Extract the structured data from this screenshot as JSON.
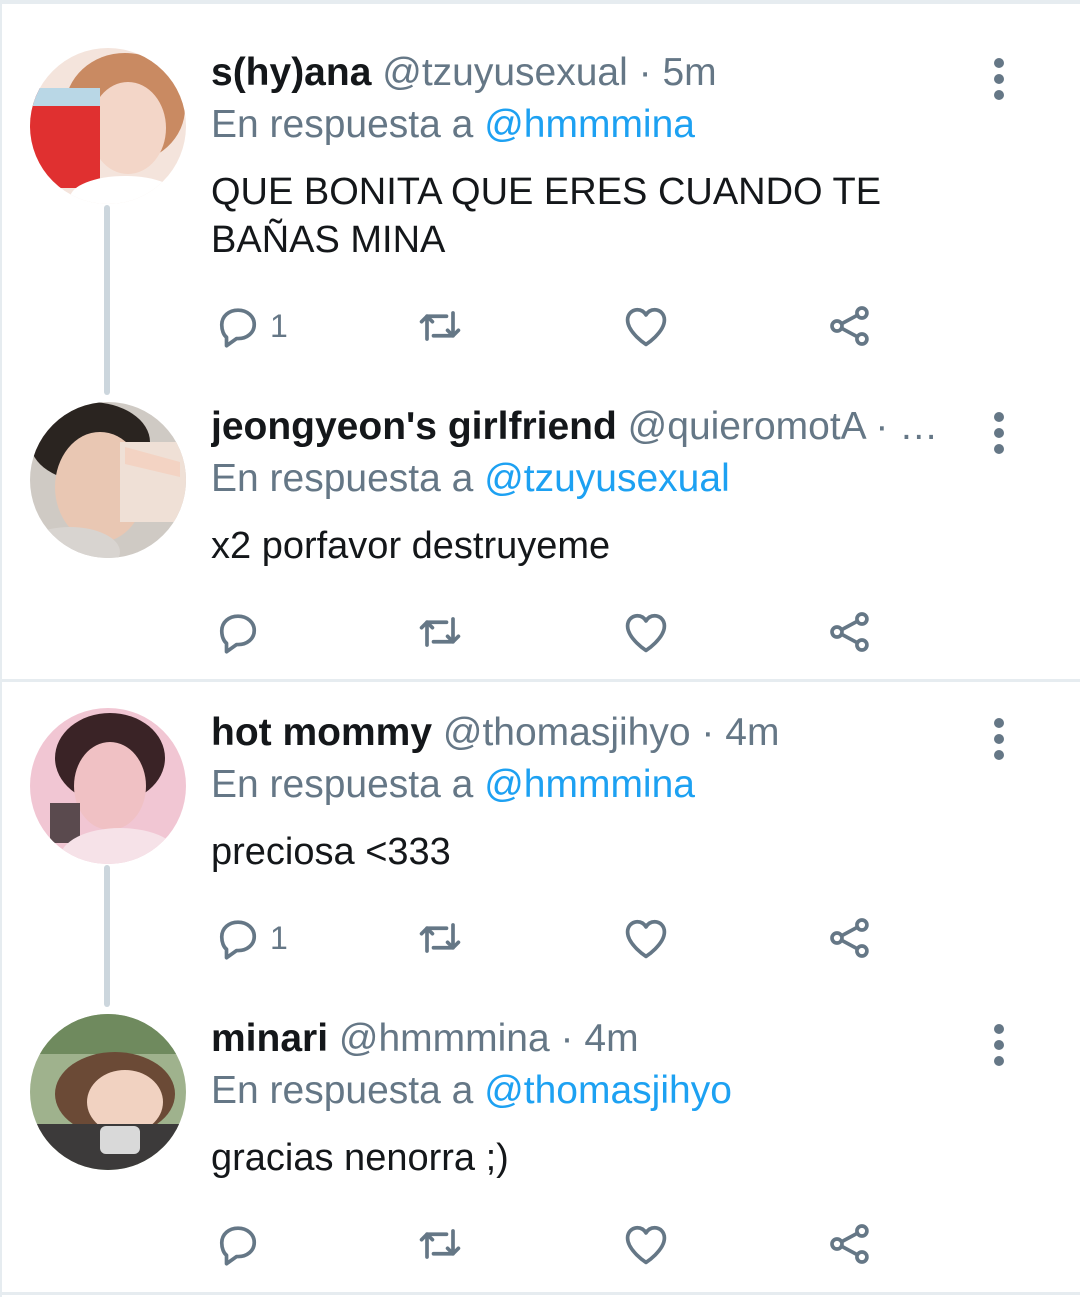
{
  "reply_prefix": "En respuesta a",
  "colors": {
    "link": "#1da1f2",
    "secondary": "#657786",
    "icon": "#657786",
    "divider": "#e6ecf0",
    "thread_line": "#ccd6dd"
  },
  "tweets": [
    {
      "display_name": "s(hy)ana",
      "handle": "@tzuyusexual",
      "separator": "·",
      "time": "5m",
      "reply_to": "@hmmmina",
      "text": "QUE BONITA QUE ERES CUANDO TE BAÑAS MINA",
      "reply_count": "1",
      "avatar_icon": "profile-photo"
    },
    {
      "display_name": "jeongyeon's girlfriend",
      "handle": "@quieromotA",
      "separator": "· …",
      "time": "",
      "reply_to": "@tzuyusexual",
      "text": "x2 porfavor destruyeme",
      "reply_count": "",
      "avatar_icon": "profile-photo"
    },
    {
      "display_name": "hot mommy",
      "handle": "@thomasjihyo",
      "separator": "·",
      "time": "4m",
      "reply_to": "@hmmmina",
      "text": "preciosa <333",
      "reply_count": "1",
      "avatar_icon": "profile-photo"
    },
    {
      "display_name": "minari",
      "handle": "@hmmmina",
      "separator": "·",
      "time": "4m",
      "reply_to": "@thomasjihyo",
      "text": "gracias nenorra ;)",
      "reply_count": "",
      "avatar_icon": "profile-photo"
    }
  ],
  "action_icons": [
    "reply-icon",
    "retweet-icon",
    "like-icon",
    "share-icon"
  ]
}
